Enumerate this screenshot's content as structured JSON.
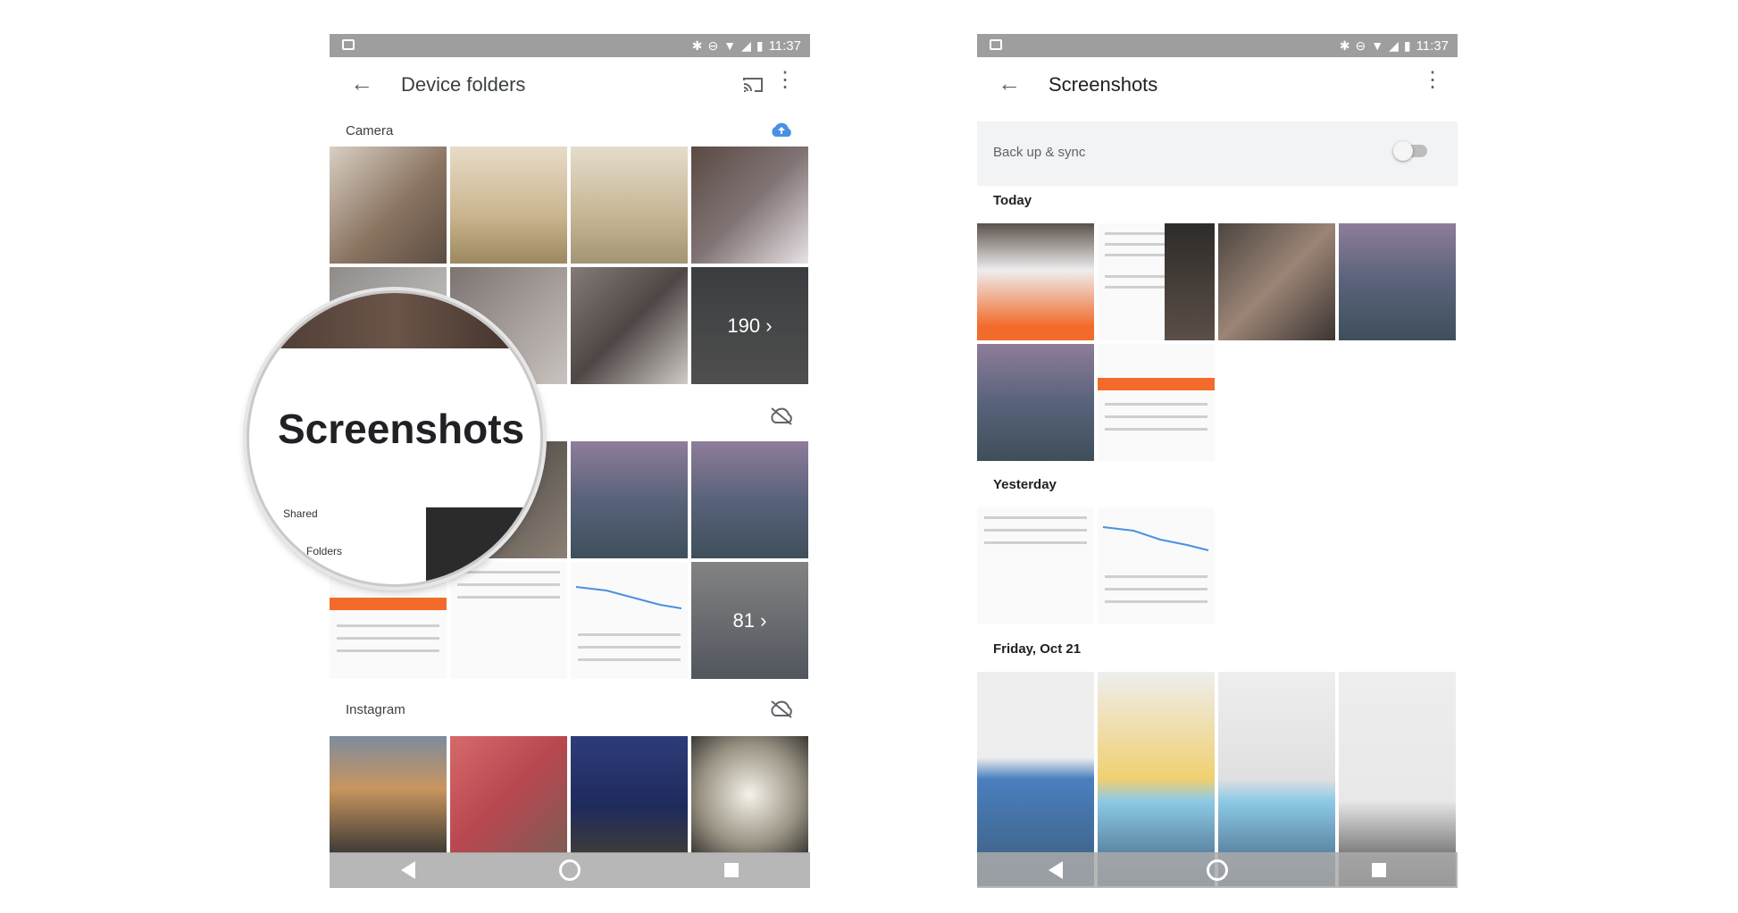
{
  "status_bar": {
    "time": "11:37"
  },
  "left": {
    "title": "Device folders",
    "sections": [
      {
        "label": "Camera",
        "count_overlay": "190 ›"
      },
      {
        "label": "Screenshots",
        "count_overlay": "81 ›"
      },
      {
        "label": "Instagram"
      }
    ],
    "magnifier_text": "Screenshots",
    "magnifier_small": [
      "Shared",
      "Folders"
    ]
  },
  "right": {
    "title": "Screenshots",
    "sync_label": "Back up & sync",
    "sections": [
      {
        "label": "Today"
      },
      {
        "label": "Yesterday"
      },
      {
        "label": "Friday, Oct 21"
      }
    ]
  },
  "icons": {
    "back": "arrow-left-icon",
    "menu": "more-vert-icon",
    "cast": "cast-icon",
    "cloud_up": "cloud-upload-icon",
    "cloud_off": "cloud-off-icon"
  },
  "colors": {
    "status_bar": "#9e9e9e",
    "accent_blue": "#4a90e2",
    "nav_bar": "#aaaaaa"
  }
}
